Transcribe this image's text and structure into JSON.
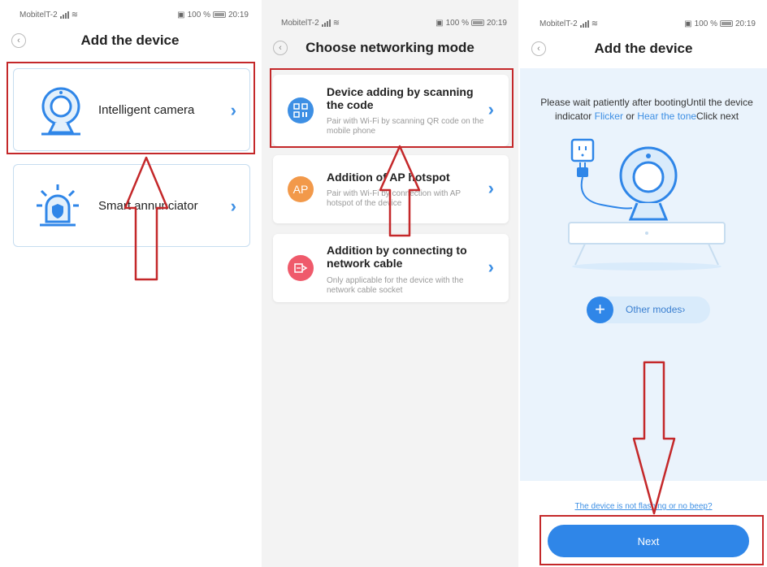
{
  "status_bar": {
    "left": [
      "MobitelT-2",
      "MobitelT-2",
      "MobitelT-2"
    ],
    "battery_text": [
      "100 %",
      "100 %",
      "100 %"
    ],
    "time": "20:19"
  },
  "screen1": {
    "title": "Add the device",
    "devices": [
      {
        "label": "Intelligent camera",
        "icon": "camera-icon"
      },
      {
        "label": "Smart annunciator",
        "icon": "alarm-icon"
      }
    ]
  },
  "screen2": {
    "title": "Choose networking mode",
    "modes": [
      {
        "title": "Device adding by scanning the code",
        "desc": "Pair with Wi-Fi by scanning QR code on the mobile phone",
        "icon": "qr-code-icon",
        "color": "#3d8fe4"
      },
      {
        "title": "Addition of AP hotspot",
        "desc": "Pair with Wi-Fi by connection with AP hotspot of the device",
        "icon_text": "AP",
        "icon": "ap-hotspot-icon",
        "color": "#f2994a"
      },
      {
        "title": "Addition by connecting to network cable",
        "desc": "Only applicable for the device with the network cable socket",
        "icon": "network-cable-icon",
        "color": "#ef5a6b"
      }
    ]
  },
  "screen3": {
    "title": "Add the device",
    "instruction": {
      "part1": "Please wait patiently after bootingUntil the device indicator ",
      "link1": "Flicker",
      "part2": " or ",
      "link2": "Hear the tone",
      "part3": "Click next"
    },
    "other_modes": "Other modes",
    "help_link": "The device is not flashing or no beep?",
    "next_button": "Next"
  },
  "colors": {
    "accent": "#2f86e8",
    "highlight_red": "#c4282a",
    "background_panel2": "#f3f3f3",
    "background_illustration": "#eaf3fc"
  },
  "icons": {
    "chevron": "chevron-right-icon",
    "back": "back-icon",
    "arrows": [
      "annotation-arrow-up-icon",
      "annotation-arrow-up-icon",
      "annotation-arrow-down-icon"
    ]
  }
}
